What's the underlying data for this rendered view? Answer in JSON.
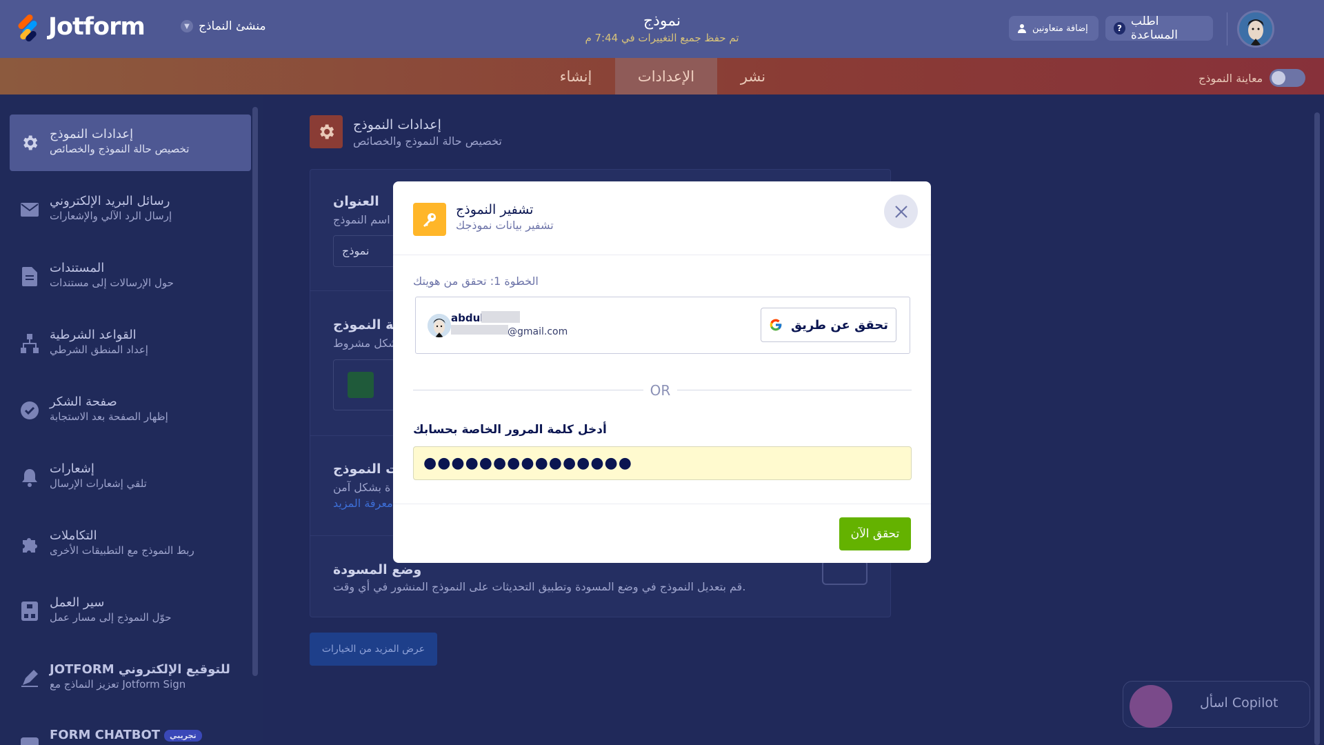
{
  "header": {
    "logo_text": "Jotform",
    "builder_label": "منشئ النماذج",
    "form_title": "نموذج",
    "saved_status": "تم حفظ جميع التغييرات في 7:44 م",
    "help_label": "اطلب المساعدة",
    "collab_label": "إضافة متعاونين"
  },
  "nav": {
    "tabs": [
      {
        "label": "إنشاء"
      },
      {
        "label": "الإعدادات"
      },
      {
        "label": "نشر"
      }
    ],
    "preview_label": "معاينة النموذج"
  },
  "sidebar": {
    "items": [
      {
        "title": "إعدادات النموذج",
        "sub": "تخصيص حالة النموذج والخصائص",
        "icon": "gear-icon"
      },
      {
        "title": "رسائل البريد الإلكتروني",
        "sub": "إرسال الرد الآلي والإشعارات",
        "icon": "mail-icon"
      },
      {
        "title": "المستندات",
        "sub": "حول الإرسالات إلى مستندات",
        "icon": "document-icon"
      },
      {
        "title": "القواعد الشرطية",
        "sub": "إعداد المنطق الشرطي",
        "icon": "conditions-icon"
      },
      {
        "title": "صفحة الشكر",
        "sub": "إظهار الصفحة بعد الاستجابة",
        "icon": "check-circle-icon"
      },
      {
        "title": "إشعارات",
        "sub": "تلقي إشعارات الإرسال",
        "icon": "bell-icon"
      },
      {
        "title": "التكاملات",
        "sub": "ربط النموذج مع التطبيقات الأخرى",
        "icon": "puzzle-icon"
      },
      {
        "title": "سير العمل",
        "sub": "حوّل النموذج إلى مسار عمل",
        "icon": "workflow-icon"
      },
      {
        "title": "JOTFORM للتوقيع الإلكتروني",
        "sub": "تعزيز النماذج مع Jotform Sign",
        "icon": "sign-icon"
      },
      {
        "title": "FORM CHATBOT",
        "sub": "",
        "icon": "chatbot-icon",
        "badge": "تجريبي"
      }
    ]
  },
  "main": {
    "section_title": "إعدادات النموذج",
    "section_sub": "تخصيص حالة النموذج والخصائص",
    "title_label": "العنوان",
    "title_sub": "اسم النموذج",
    "title_value": "نموذج",
    "status_label": "حالة النموذج",
    "status_sub": "شكل مشروط",
    "encrypt_label": "ت النموذج",
    "encrypt_sub": "ة بشكل آمن",
    "encrypt_link": "معرفة المزيد",
    "draft_label": "وضع المسودة",
    "draft_sub": "قم بتعديل النموذج في وضع المسودة وتطبيق التحديثات على النموذج المنشور في أي وقت.",
    "more_options": "عرض المزيد من الخيارات",
    "copilot_label": "اسأل Copilot"
  },
  "modal": {
    "title": "تشفير النموذج",
    "subtitle": "تشفير بيانات نموذجك",
    "step_label": "الخطوة 1: تحقق من هويتك",
    "account_name": "abdul",
    "account_email": "@gmail.com",
    "google_button": "تحقق عن طريق",
    "or_text": "OR",
    "password_label": "أدخل كلمة المرور الخاصة بحسابك",
    "password_value": "●●●●●●●●●●●●●●●",
    "verify_button": "تحقق الآن"
  },
  "colors": {
    "accent_orange": "#ffb629",
    "verify_green": "#64b200",
    "password_bg": "#fffacf"
  }
}
